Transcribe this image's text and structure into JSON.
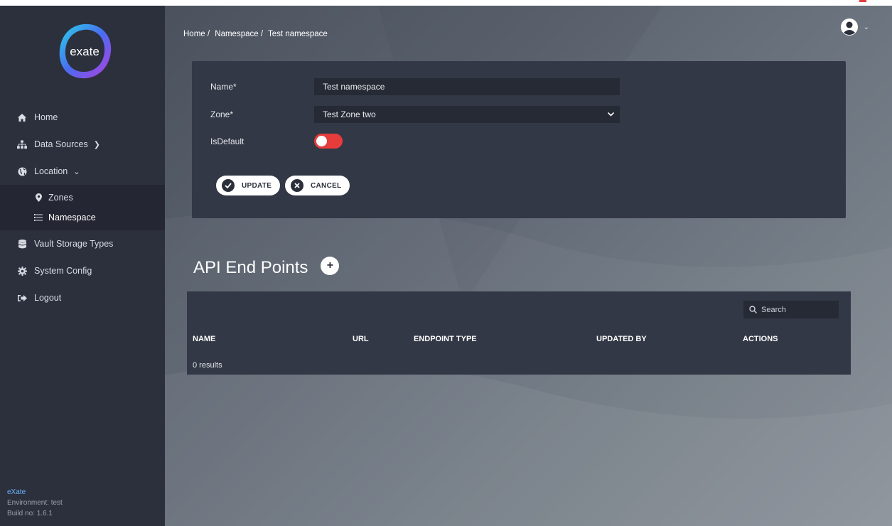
{
  "sidebar": {
    "logo_text": "exate",
    "items": [
      {
        "label": "Home",
        "icon": "home-icon"
      },
      {
        "label": "Data Sources",
        "icon": "sitemap-icon"
      },
      {
        "label": "Location",
        "icon": "globe-icon"
      },
      {
        "label": "Vault Storage Types",
        "icon": "database-icon"
      },
      {
        "label": "System Config",
        "icon": "gear-icon"
      },
      {
        "label": "Logout",
        "icon": "logout-icon"
      }
    ],
    "subitems": [
      {
        "label": "Zones",
        "icon": "map-marker-icon"
      },
      {
        "label": "Namespace",
        "icon": "list-icon",
        "active": true
      }
    ],
    "footer": {
      "brand": "eXate",
      "environment": "Environment: test",
      "build": "Build no: 1.6.1"
    }
  },
  "breadcrumb": [
    "Home /",
    "Namespace /",
    "Test namespace"
  ],
  "form": {
    "name_label": "Name*",
    "name_value": "Test namespace",
    "zone_label": "Zone*",
    "zone_value": "Test Zone two",
    "isdefault_label": "IsDefault",
    "isdefault_on": false,
    "update_label": "UPDATE",
    "cancel_label": "CANCEL"
  },
  "api": {
    "title": "API End Points",
    "add_label": "+",
    "search_placeholder": "Search",
    "columns": [
      "NAME",
      "URL",
      "ENDPOINT TYPE",
      "UPDATED BY",
      "ACTIONS"
    ],
    "results_text": "0 results"
  },
  "colors": {
    "sidebar_bg": "#2c303d",
    "card_bg": "#333846",
    "toggle_off": "#e63c3c",
    "brand_blue": "#6db3ff"
  }
}
